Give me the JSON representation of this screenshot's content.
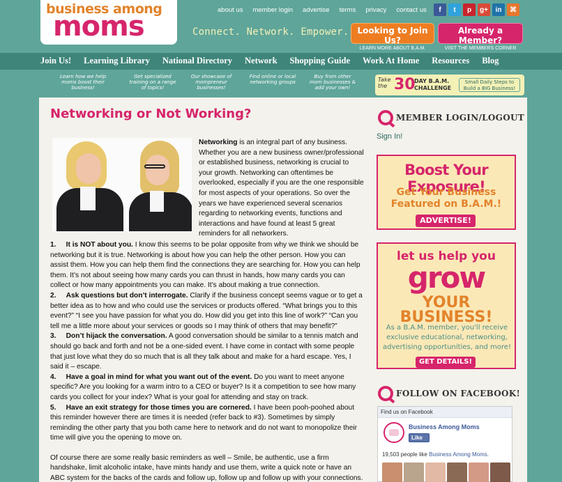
{
  "header": {
    "logo_top": "business among",
    "logo_main": "moms",
    "top_links": [
      "about us",
      "member login",
      "advertise",
      "terms",
      "privacy",
      "contact us"
    ],
    "social_icons": [
      {
        "name": "facebook-icon",
        "glyph": "f",
        "color": "#3b5998"
      },
      {
        "name": "twitter-icon",
        "glyph": "t",
        "color": "#2fa2dc"
      },
      {
        "name": "pinterest-icon",
        "glyph": "p",
        "color": "#c8232c"
      },
      {
        "name": "google-plus-icon",
        "glyph": "g+",
        "color": "#d84a38"
      },
      {
        "name": "linkedin-icon",
        "glyph": "in",
        "color": "#1f73a8"
      },
      {
        "name": "rss-icon",
        "glyph": "⌘",
        "color": "#e8762c"
      }
    ],
    "tagline": "Connect. Network. Empower.",
    "cta_join": {
      "title": "Looking to Join Us?",
      "sub": "LEARN MORE ABOUT B.A.M."
    },
    "cta_member": {
      "title": "Already a Member?",
      "sub": "VISIT THE MEMBERS CORNER"
    }
  },
  "nav": {
    "items": [
      "Join Us!",
      "Learning Library",
      "National Directory",
      "Network",
      "Shopping Guide",
      "Work At Home",
      "Resources",
      "Blog"
    ]
  },
  "subnav": {
    "hints": [
      "Learn how we help moms boost their business!",
      "Get specialized training on a range of topics!",
      "Our showcase of mompreneur businesses!",
      "Find online or local networking groups",
      "Buy from other mom businesses & add your own!"
    ],
    "challenge": {
      "take": "Take the",
      "number": "30",
      "label": "DAY B.A.M. CHALLENGE",
      "small": "Small Daily Steps to Build a BIG Business!"
    }
  },
  "article": {
    "title": "Networking or Not Working?",
    "intro_bold": "Networking",
    "intro_rest": " is an integral part of any business. Whether you are a new business owner/professional or established business, networking is crucial to your growth.  Networking can oftentimes be overlooked, especially if you are the one responsible for most aspects of your operations.  So over the years we have experienced several scenarios regarding to networking events, functions and interactions and have found at least 5 great reminders for all networkers.",
    "points": [
      {
        "num": "1.",
        "head": "It is NOT about you.",
        "text": "  I know this seems to be polar opposite from why we think we should be networking but it is true.  Networking is about how you can help the other person.  How you can assist them.  How you can help them find the connections they are searching for.  How you can help them.  It’s not about seeing how many cards you can thrust in hands, how many cards you can collect or how many appointments you can make.  It’s about making a true connection."
      },
      {
        "num": "2.",
        "head": "Ask questions but don’t interrogate.",
        "text": "  Clarify if the business concept seems vague or to get a better idea as to how and who could use the services or products offered.  “What brings you to this event?” “I see you have passion for what you do.  How did you get into this line of work?”  “Can you tell me a little more about your services or goods so I may think of others that may benefit?”"
      },
      {
        "num": "3.",
        "head": "Don’t hijack the conversation.",
        "text": "  A good conversation should be similar to a tennis match and should go back and forth and not be a one-sided event.  I have come in contact with some people that just love what they do so much that is all they talk about and make for a hard escape.  Yes, I said it – escape."
      },
      {
        "num": "4.",
        "head": "Have a goal in mind for what you want out of the event.",
        "text": "  Do you want to meet anyone specific?  Are you looking for a warm intro to a CEO or buyer?  Is it a competition to see how many cards you collect for your index?  What is your goal for attending and stay on track."
      },
      {
        "num": "5.",
        "head": "Have an exit strategy for those times you are cornered.",
        "text": "  I have been pooh-poohed about this reminder however there are times it is needed (refer back to #3).  Sometimes by simply reminding the other party that you both came here to network and do not want to monopolize their time will give you the opening to move on."
      }
    ],
    "closing": "Of course there are some really basic reminders as well – Smile, be authentic, use a firm handshake, limit alcoholic intake, have mints handy and use them, write a quick note or have an ABC system for the backs of the cards and follow up, follow up and follow up with your connections."
  },
  "sidebar": {
    "login_heading": "MEMBER LOGIN/LOGOUT",
    "sign_in": "Sign In!",
    "ad1": {
      "headline": "Boost Your Exposure!",
      "sub": "Get Your Business Featured on B.A.M.!",
      "button": "ADVERTISE!"
    },
    "ad2": {
      "line1": "let us help you",
      "line2": "grow",
      "line3": "YOUR BUSINESS!",
      "desc": "As a B.A.M. member, you'll receive exclusive educational, networking, advertising opportunities, and more!",
      "button": "GET DETAILS!"
    },
    "fb_heading": "FOLLOW ON FACEBOOK!",
    "fb": {
      "top": "Find us on Facebook",
      "page_name": "Business Among Moms",
      "like": "Like",
      "count_prefix": "19,503 people like ",
      "count_link": "Business Among Moms",
      "count_suffix": "."
    }
  },
  "colors": {
    "teal": "#5fa59a",
    "teal_dark": "#3f857a",
    "pink": "#d6256b",
    "orange": "#ee7d22",
    "cream": "#f3f1b6"
  }
}
